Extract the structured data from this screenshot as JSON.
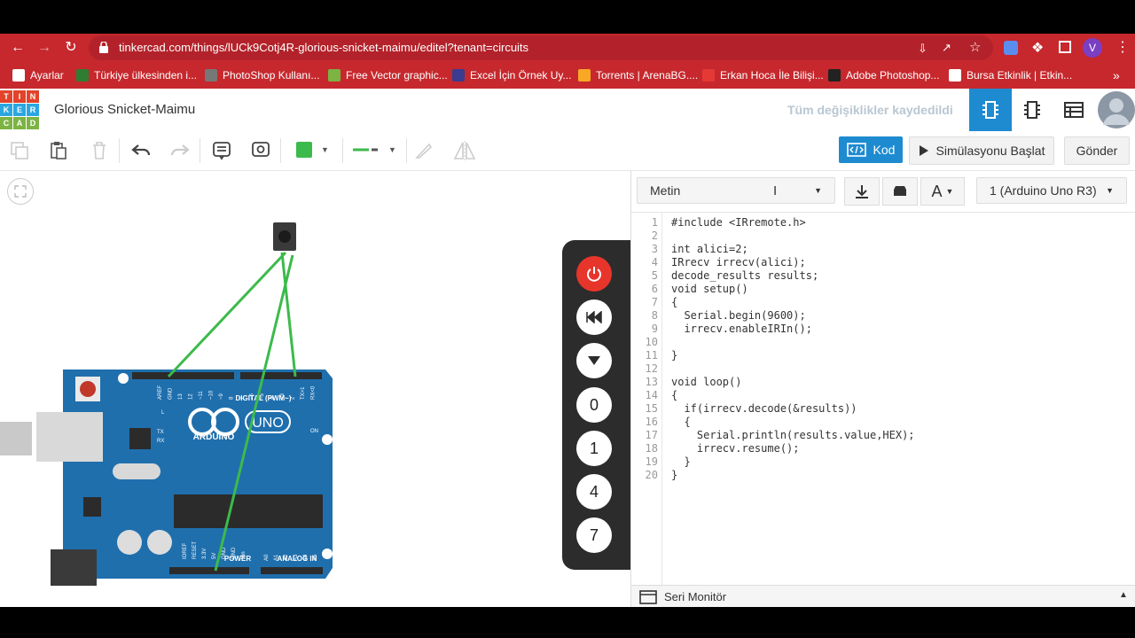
{
  "browser": {
    "url": "tinkercad.com/things/lUCk9Cotj4R-glorious-snicket-maimu/editel?tenant=circuits",
    "profile_initial": "V",
    "bookmarks": [
      {
        "label": "Ayarlar",
        "color": "#ffffff"
      },
      {
        "label": "Türkiye ülkesinden i...",
        "color": "#2e7d32"
      },
      {
        "label": "PhotoShop Kullanı...",
        "color": "#777777"
      },
      {
        "label": "Free Vector graphic...",
        "color": "#7cb342"
      },
      {
        "label": "Excel İçin Örnek Uy...",
        "color": "#3b3b8f"
      },
      {
        "label": "Torrents | ArenaBG....",
        "color": "#f9a825"
      },
      {
        "label": "Erkan Hoca İle Bilişi...",
        "color": "#e53935"
      },
      {
        "label": "Adobe Photoshop...",
        "color": "#222222"
      },
      {
        "label": "Bursa Etkinlik | Etkin...",
        "color": "#ffffff"
      }
    ],
    "more": "»"
  },
  "app": {
    "logo_letters": [
      "T",
      "I",
      "N",
      "K",
      "E",
      "R",
      "C",
      "A",
      "D"
    ],
    "logo_colors": [
      "#e2432a",
      "#e2432a",
      "#e2432a",
      "#2aa7e0",
      "#2aa7e0",
      "#2aa7e0",
      "#7cb342",
      "#7cb342",
      "#7cb342"
    ],
    "project_title": "Glorious Snicket-Maimu",
    "save_status": "Tüm değişiklikler kaydedildi"
  },
  "toolbar": {
    "kod_label": "Kod",
    "simulate_label": "Simülasyonu Başlat",
    "send_label": "Gönder",
    "fill_color": "#3cba4b",
    "line_color": "#3cba4b"
  },
  "code": {
    "mode_select": "Metin",
    "device_select": "1 (Arduino Uno R3)",
    "lines": [
      "#include <IRremote.h>",
      "",
      "int alici=2;",
      "IRrecv irrecv(alici);",
      "decode_results results;",
      "void setup()",
      "{",
      "  Serial.begin(9600);",
      "  irrecv.enableIRIn();",
      "",
      "}",
      "",
      "void loop()",
      "{",
      "  if(irrecv.decode(&results))",
      "  {",
      "    Serial.println(results.value,HEX);",
      "    irrecv.resume();",
      "  }",
      "}"
    ],
    "serial_monitor_label": "Seri Monitör"
  },
  "board": {
    "logo_text": "ARDUINO",
    "model": "UNO",
    "digital_label": "DIGITAL (PWM~)",
    "power_label": "POWER",
    "analog_label": "ANALOG IN",
    "on_label": "ON",
    "tx_label": "TX",
    "rx_label": "RX",
    "l_label": "L",
    "digital_pins": [
      "AREF",
      "GND",
      "13",
      "12",
      "~11",
      "~10",
      "~9",
      "8",
      "7",
      "~6",
      "~5",
      "4",
      "~3",
      "2",
      "TX>1",
      "RX<0"
    ],
    "power_pins": [
      "IOREF",
      "RESET",
      "3.3V",
      "5V",
      "GND",
      "GND",
      "Vin"
    ],
    "analog_pins": [
      "A0",
      "A1",
      "A2",
      "A3",
      "A4",
      "A5"
    ]
  },
  "remote": {
    "buttons": [
      "0",
      "1",
      "4",
      "7"
    ]
  }
}
